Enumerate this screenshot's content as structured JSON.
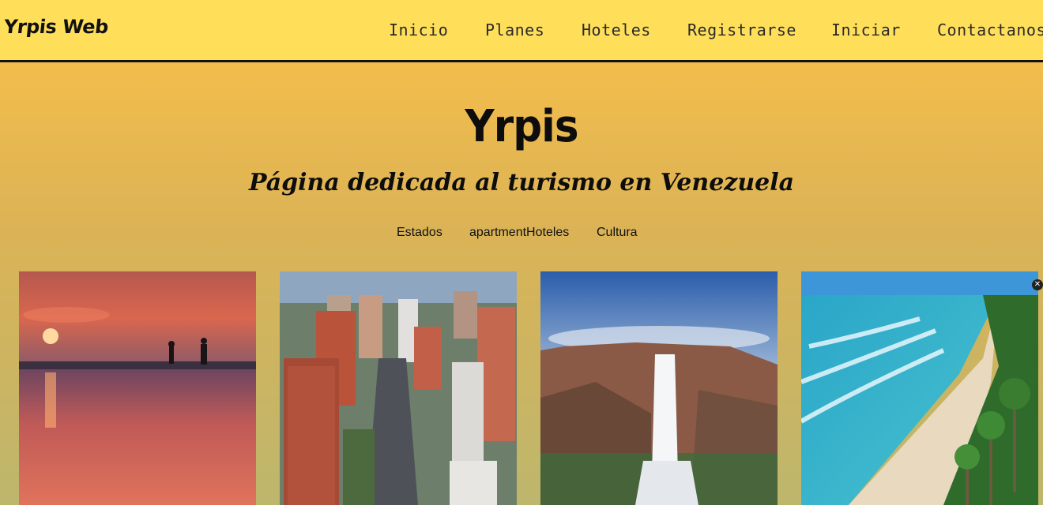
{
  "header": {
    "brand": "Yrpis Web",
    "nav": [
      {
        "label": "Inicio"
      },
      {
        "label": "Planes"
      },
      {
        "label": "Hoteles"
      },
      {
        "label": "Registrarse"
      },
      {
        "label": "Iniciar"
      },
      {
        "label": "Contactanos"
      }
    ]
  },
  "hero": {
    "title": "Yrpis",
    "subtitle": "Página dedicada al turismo en Venezuela"
  },
  "subnav": [
    {
      "label": "Estados"
    },
    {
      "label": "apartmentHoteles"
    },
    {
      "label": "Cultura"
    }
  ],
  "gallery": [
    {
      "icon": "sunset-lake-riders-image"
    },
    {
      "icon": "city-skyline-image"
    },
    {
      "icon": "waterfall-tepui-image"
    },
    {
      "icon": "beach-palms-image"
    }
  ],
  "colors": {
    "header_bg": "#ffdf5a",
    "page_gradient_top": "#f3bd4c",
    "page_gradient_bottom": "#bdb66d",
    "text": "#111111"
  }
}
